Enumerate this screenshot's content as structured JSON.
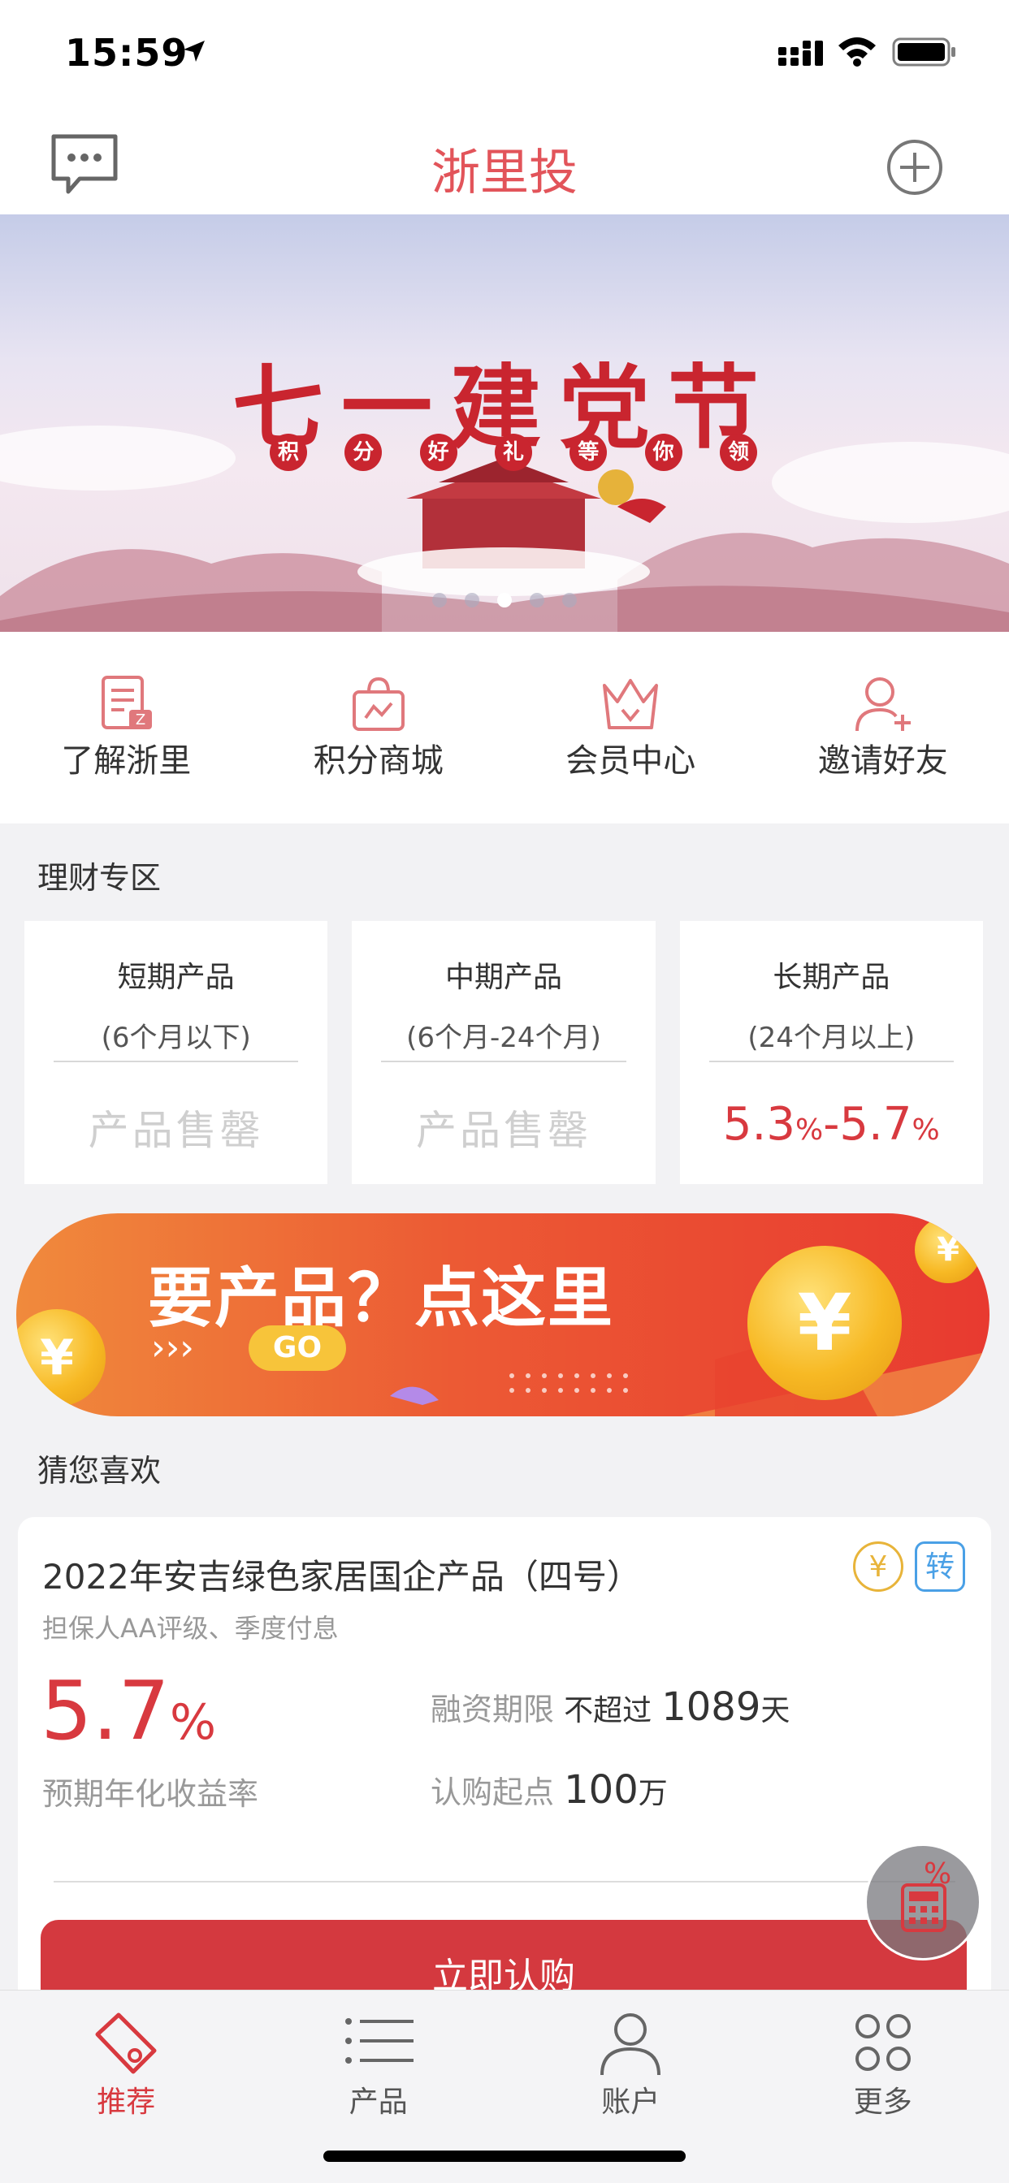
{
  "status": {
    "time": "15:59"
  },
  "nav": {
    "title": "浙里投"
  },
  "banner": {
    "title": "七一建党节",
    "sub": [
      "积",
      "分",
      "好",
      "礼",
      "等",
      "你",
      "领"
    ],
    "page_count": 5,
    "active_index": 2
  },
  "quick_menu": [
    {
      "label": "了解浙里",
      "icon": "document-icon"
    },
    {
      "label": "积分商城",
      "icon": "shopping-bag-icon"
    },
    {
      "label": "会员中心",
      "icon": "crown-icon"
    },
    {
      "label": "邀请好友",
      "icon": "add-user-icon"
    }
  ],
  "finance": {
    "title": "理财专区",
    "cards": [
      {
        "name": "短期产品",
        "term": "(6个月以下)",
        "status": "产品售罄"
      },
      {
        "name": "中期产品",
        "term": "(6个月-24个月)",
        "status": "产品售罄"
      },
      {
        "name": "长期产品",
        "term": "(24个月以上)",
        "rate_low": "5.3",
        "rate_high": "5.7",
        "pct": "%",
        "dash": "-"
      }
    ]
  },
  "promo": {
    "text": "要产品？点这里",
    "arrows": "›››",
    "go": "GO"
  },
  "recommend": {
    "title": "猜您喜欢",
    "product": {
      "name": "2022年安吉绿色家居国企产品（四号）",
      "desc": "担保人AA评级、季度付息",
      "badge_yen": "¥",
      "badge_transfer": "转",
      "rate": "5.7",
      "rate_unit": "%",
      "rate_label": "预期年化收益率",
      "term_label": "融资期限",
      "term_prefix": "不超过",
      "term_value": "1089",
      "term_unit": "天",
      "min_label": "认购起点",
      "min_value": "100",
      "min_unit": "万",
      "buy": "立即认购"
    }
  },
  "calculator": {
    "label": "%"
  },
  "tabs": [
    {
      "label": "推荐",
      "icon": "price-tag-icon",
      "active": true
    },
    {
      "label": "产品",
      "icon": "list-icon",
      "active": false
    },
    {
      "label": "账户",
      "icon": "person-icon",
      "active": false
    },
    {
      "label": "更多",
      "icon": "more-grid-icon",
      "active": false
    }
  ],
  "colors": {
    "accent": "#d8393f",
    "title": "#e2545a",
    "gold": "#e8b43a",
    "blue": "#4aa0e6"
  }
}
